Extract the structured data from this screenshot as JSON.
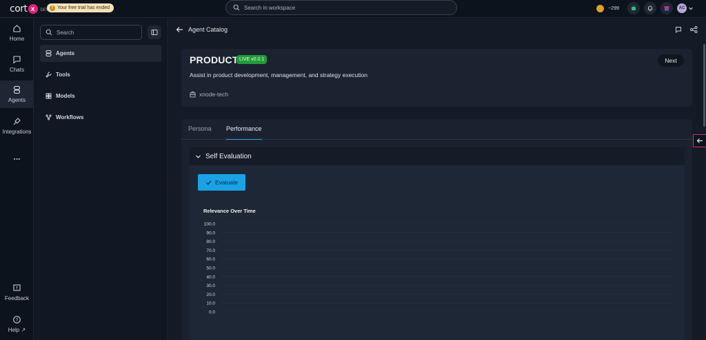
{
  "topbar": {
    "logo_text": "cort",
    "logo_mark": "x",
    "logo_badge": "DEV",
    "trial_notice": "Your free trial has ended",
    "search_placeholder": "Search in workspace",
    "credits": "~299",
    "avatar_initials": "AC"
  },
  "rail": {
    "items": [
      {
        "label": "Home",
        "icon": "home-icon"
      },
      {
        "label": "Chats",
        "icon": "chat-icon"
      },
      {
        "label": "Agents",
        "icon": "agents-icon",
        "active": true
      },
      {
        "label": "Integrations",
        "icon": "plug-icon"
      },
      {
        "label": "...",
        "icon": "more-icon"
      }
    ],
    "feedback_label": "Feedback",
    "help_label": "Help"
  },
  "sidebar": {
    "search_placeholder": "Search",
    "items": [
      {
        "label": "Agents",
        "active": true
      },
      {
        "label": "Tools"
      },
      {
        "label": "Models"
      },
      {
        "label": "Workflows"
      }
    ]
  },
  "main": {
    "breadcrumb": "Agent Catalog",
    "agent": {
      "name": "PRODUCT",
      "status_badge": "LIVE v0.0.1",
      "description": "Assist in product development, management, and strategy execution",
      "org": "xnode-tech",
      "next_label": "Next"
    },
    "tabs": [
      {
        "label": "Persona"
      },
      {
        "label": "Performance",
        "active": true
      }
    ],
    "self_evaluation": {
      "title": "Self Evaluation",
      "evaluate_label": "Evaluate"
    }
  },
  "chart_data": {
    "type": "line",
    "title": "Relevance Over Time",
    "xlabel": "",
    "ylabel": "",
    "ylim": [
      0,
      100
    ],
    "yticks": [
      "100.0",
      "90.0",
      "80.0",
      "70.0",
      "60.0",
      "50.0",
      "40.0",
      "30.0",
      "20.0",
      "10.0",
      "0.0"
    ],
    "series": [],
    "grid": true
  },
  "colors": {
    "accent": "#1aa2e6",
    "live_badge": "#1f9d3a",
    "brand": "#e8207a"
  }
}
